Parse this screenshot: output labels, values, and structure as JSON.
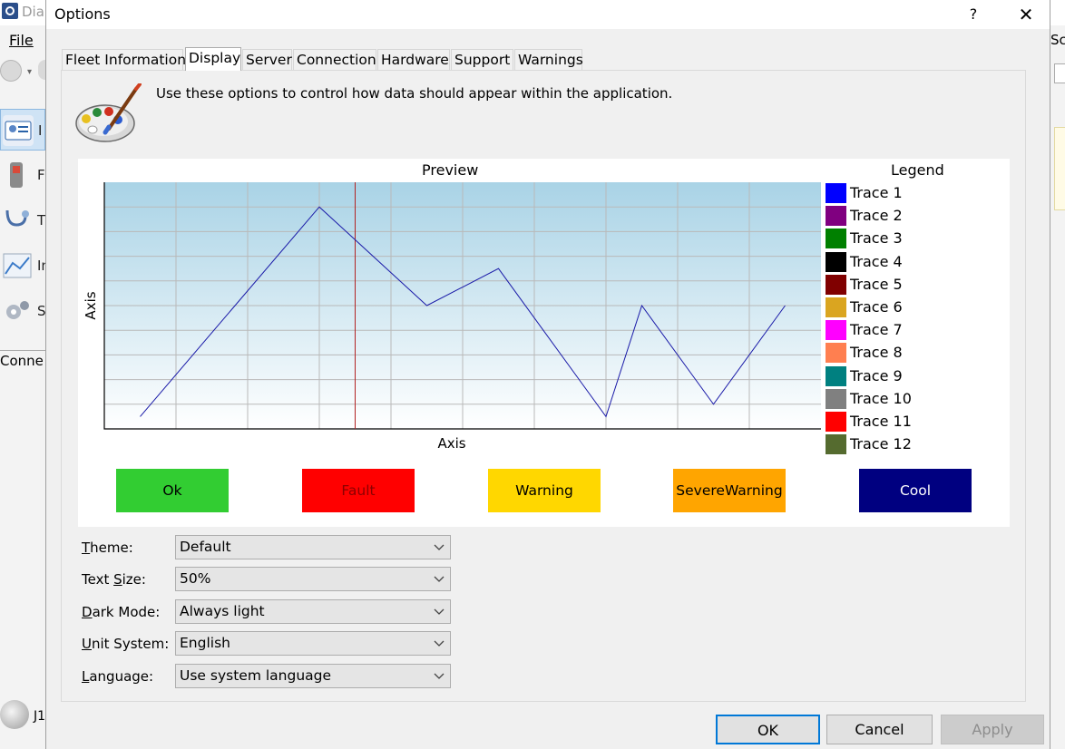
{
  "background": {
    "app_title": "Dia",
    "menu_file": "File",
    "sidebar_letters": [
      "I",
      "F",
      "T",
      "In",
      "S"
    ],
    "connection_label": "Conne",
    "bottom_label": "J1",
    "right_label": "Sc"
  },
  "dialog": {
    "title": "Options",
    "help_glyph": "?",
    "close_glyph": "✕"
  },
  "tabs": [
    {
      "label": "Fleet Information",
      "active": false
    },
    {
      "label": "Display",
      "active": true
    },
    {
      "label": "Server",
      "active": false
    },
    {
      "label": "Connection",
      "active": false
    },
    {
      "label": "Hardware",
      "active": false
    },
    {
      "label": "Support",
      "active": false
    },
    {
      "label": "Warnings",
      "active": false
    }
  ],
  "display": {
    "intro": "Use these options to control how data should appear within the application.",
    "icon": "palette-icon"
  },
  "chart_data": {
    "type": "line",
    "title": "Preview",
    "xlabel": "Axis",
    "ylabel": "Axis",
    "legend_title": "Legend",
    "legend_position": "right",
    "grid": true,
    "x_divisions": 10,
    "y_divisions": 10,
    "xlim": [
      0,
      10
    ],
    "ylim": [
      0,
      10
    ],
    "cursor_x": 3.5,
    "series": [
      {
        "x": [
          0.5,
          3.0,
          4.5,
          5.5,
          7.0,
          7.5,
          8.5,
          9.5
        ],
        "y": [
          0.5,
          9.0,
          5.0,
          6.5,
          0.5,
          5.0,
          1.0,
          5.0
        ]
      }
    ],
    "traces": [
      {
        "name": "Trace 1",
        "color": "#0000ff"
      },
      {
        "name": "Trace 2",
        "color": "#800080"
      },
      {
        "name": "Trace 3",
        "color": "#008000"
      },
      {
        "name": "Trace 4",
        "color": "#000000"
      },
      {
        "name": "Trace 5",
        "color": "#800000"
      },
      {
        "name": "Trace 6",
        "color": "#daa520"
      },
      {
        "name": "Trace 7",
        "color": "#ff00ff"
      },
      {
        "name": "Trace 8",
        "color": "#ff7f50"
      },
      {
        "name": "Trace 9",
        "color": "#008080"
      },
      {
        "name": "Trace 10",
        "color": "#808080"
      },
      {
        "name": "Trace 11",
        "color": "#ff0000"
      },
      {
        "name": "Trace 12",
        "color": "#556b2f"
      }
    ],
    "line_color": "#1a1aa8",
    "cursor_color": "#b22222"
  },
  "status_buttons": [
    {
      "label": "Ok",
      "bg": "#32cd32",
      "fg": "#000000"
    },
    {
      "label": "Fault",
      "bg": "#ff0000",
      "fg": "#8b0000"
    },
    {
      "label": "Warning",
      "bg": "#ffd700",
      "fg": "#000000"
    },
    {
      "label": "SevereWarning",
      "bg": "#ffa500",
      "fg": "#000000"
    },
    {
      "label": "Cool",
      "bg": "#000080",
      "fg": "#ffffff"
    }
  ],
  "form": {
    "theme": {
      "label_u": "T",
      "label_rest": "heme:",
      "value": "Default"
    },
    "text_size": {
      "label_pre": "Text ",
      "label_u": "S",
      "label_rest": "ize:",
      "value": "50%"
    },
    "dark_mode": {
      "label_u": "D",
      "label_rest": "ark Mode:",
      "value": "Always light"
    },
    "unit_system": {
      "label_u": "U",
      "label_rest": "nit System:",
      "value": "English"
    },
    "language": {
      "label_u": "L",
      "label_rest": "anguage:",
      "value": "Use system language"
    }
  },
  "footer": {
    "ok": "OK",
    "cancel": "Cancel",
    "apply": "Apply"
  }
}
